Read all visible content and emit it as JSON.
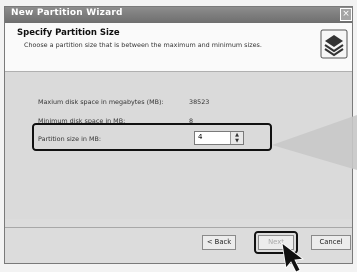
{
  "window": {
    "title": "New Partition Wizard",
    "close_glyph": "×"
  },
  "header": {
    "heading": "Specify Partition Size",
    "subtitle": "Choose a partition size that is between the maximum and minimum sizes.",
    "icon": "disk-drive-icon"
  },
  "fields": {
    "max_label": "Maxium disk space in megabytes (MB):",
    "max_value": "38523",
    "min_label": "Minimum disk space in MB:",
    "min_value": "8",
    "size_label": "Partition size in MB:",
    "size_value": "4"
  },
  "buttons": {
    "back": "< Back",
    "next": "Next",
    "cancel": "Cancel"
  },
  "annotations": {
    "callout_color": "#c8c8c8",
    "highlight_color": "#111111",
    "pointer": "mouse-pointer-icon"
  }
}
